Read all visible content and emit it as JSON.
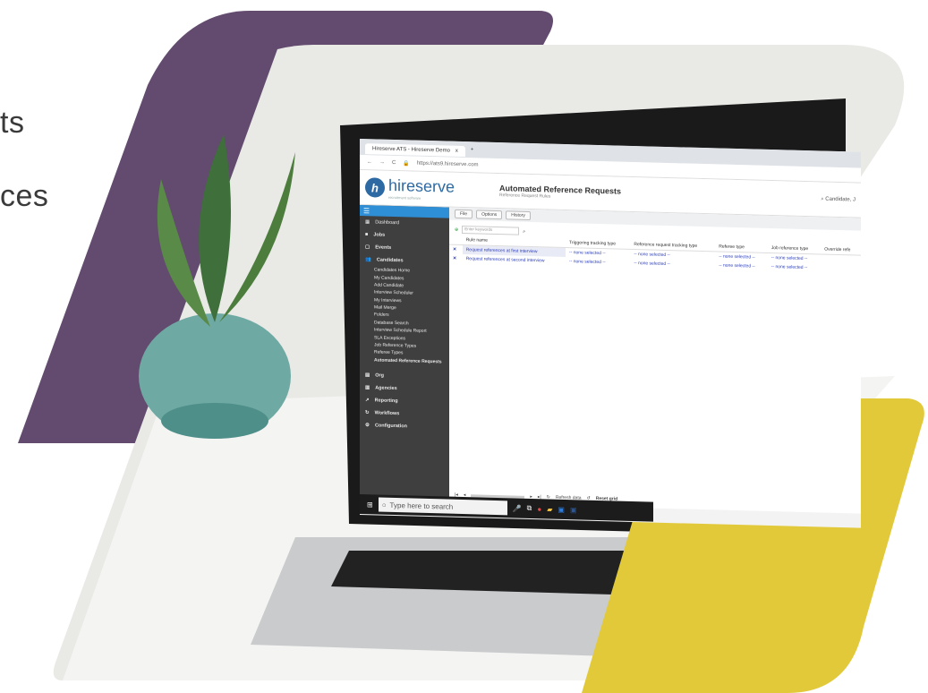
{
  "fragments": [
    "ts",
    "ces"
  ],
  "colors": {
    "purple": "#624b6e",
    "yellow": "#e2c93a",
    "brand_blue": "#2d6aa3",
    "sidebar_dark": "#3f3f3f",
    "link_blue": "#2b3fbf"
  },
  "browser": {
    "tab_title": "Hireserve ATS - Hireserve Demo",
    "tab_close": "x",
    "new_tab": "+",
    "url": "https://ats9.hireserve.com"
  },
  "app": {
    "logo_text": "hireserve",
    "logo_sub": "recruitment software",
    "page_title": "Automated Reference Requests",
    "page_subtitle": "Reference Request Rules",
    "search_text": "Candidate, J"
  },
  "sidebar": {
    "nav": [
      {
        "label": "Dashboard",
        "icon": "dashboard-icon",
        "bold": false
      },
      {
        "label": "Jobs",
        "icon": "briefcase-icon",
        "bold": true
      },
      {
        "label": "Events",
        "icon": "calendar-icon",
        "bold": true
      },
      {
        "label": "Candidates",
        "icon": "people-icon",
        "bold": true
      }
    ],
    "sub_items": [
      "Candidates Home",
      "My Candidates",
      "Add Candidate",
      "Interview Scheduler",
      "My Interviews",
      "Mail Merge",
      "Folders",
      "Database Search",
      "Interview Schedule Report",
      "SLA Exceptions",
      "Job Reference Types",
      "Referee Types",
      "Automated Reference Requests"
    ],
    "nav_bottom": [
      {
        "label": "Org",
        "icon": "org-icon"
      },
      {
        "label": "Agencies",
        "icon": "agencies-icon"
      },
      {
        "label": "Reporting",
        "icon": "chart-icon"
      },
      {
        "label": "Workflows",
        "icon": "workflow-icon"
      },
      {
        "label": "Configuration",
        "icon": "gear-icon"
      }
    ]
  },
  "toolbar": {
    "buttons": [
      "File",
      "Options",
      "History"
    ]
  },
  "grid": {
    "keyword_placeholder": "Enter keywords",
    "columns": [
      "Rule name",
      "Triggering tracking type",
      "Reference request tracking type",
      "Referee type",
      "Job reference type",
      "Override refe"
    ],
    "rows": [
      {
        "name": "Request references at first interview",
        "cells": [
          "-- none selected --",
          "-- none selected --",
          "-- none selected --",
          "-- none selected --",
          ""
        ]
      },
      {
        "name": "Request references at second interview",
        "cells": [
          "-- none selected --",
          "-- none selected --",
          "-- none selected --",
          "-- none selected --",
          ""
        ]
      }
    ]
  },
  "pager": {
    "refresh": "Refresh data",
    "reset": "Reset grid"
  },
  "taskbar": {
    "search_placeholder": "Type here to search"
  }
}
